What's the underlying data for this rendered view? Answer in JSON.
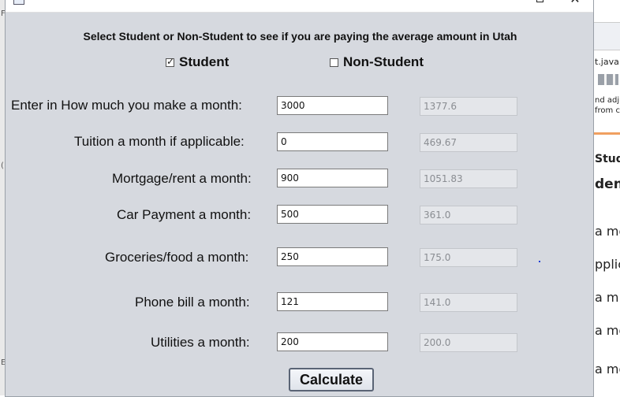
{
  "heading": "Select Student or Non-Student to see if you are paying the average amount in Utah",
  "options": {
    "student": {
      "label": "Student",
      "checked": true
    },
    "non_student": {
      "label": "Non-Student",
      "checked": false
    }
  },
  "rows": [
    {
      "label": "Enter in How much you make a month:",
      "input": "3000",
      "average": "1377.6"
    },
    {
      "label": "Tuition a month if applicable:",
      "input": "0",
      "average": "469.67"
    },
    {
      "label": "Mortgage/rent a month:",
      "input": "900",
      "average": "1051.83"
    },
    {
      "label": "Car Payment a month:",
      "input": "500",
      "average": "361.0"
    },
    {
      "label": "Groceries/food a month:",
      "input": "250",
      "average": "175.0"
    },
    {
      "label": "Phone bill a month:",
      "input": "121",
      "average": "141.0"
    },
    {
      "label": "Utilities a month:",
      "input": "200",
      "average": "200.0"
    }
  ],
  "calculate_label": "Calculate",
  "background": {
    "left_letters": [
      "F",
      "(",
      "E"
    ],
    "right_texts": [
      "t.java",
      "nd adju",
      "from co",
      "Stud",
      "den",
      "a mo",
      "pplic",
      "a m",
      "a mo",
      "a mo"
    ]
  },
  "colors": {
    "dialog_bg": "#d6d9df",
    "output_text": "#8a8d92"
  }
}
